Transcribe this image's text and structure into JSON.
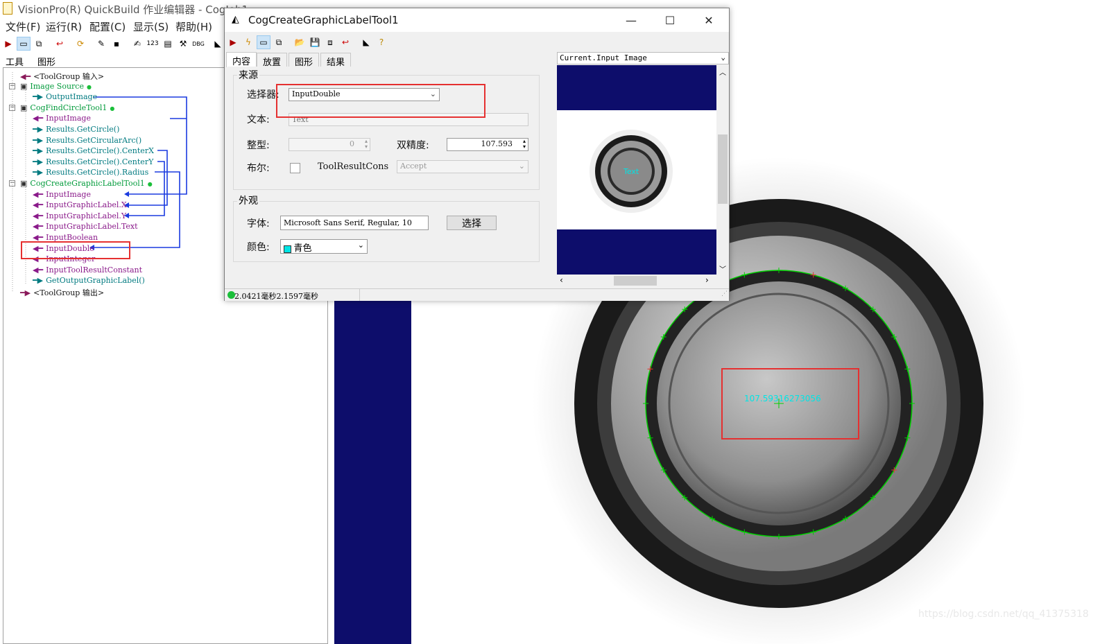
{
  "main_window": {
    "title": "VisionPro(R) QuickBuild 作业编辑器 - CogJob1",
    "menu": [
      "文件(F)",
      "运行(R)",
      "配置(C)",
      "显示(S)",
      "帮助(H)"
    ],
    "left_tabs": [
      "工具",
      "图形"
    ]
  },
  "tree": {
    "items": [
      {
        "label": "<ToolGroup 输入>",
        "color": "black"
      },
      {
        "label": "Image Source",
        "color": "green"
      },
      {
        "label": "OutputImage",
        "color": "teal"
      },
      {
        "label": "CogFindCircleTool1",
        "color": "green"
      },
      {
        "label": "InputImage",
        "color": "purple"
      },
      {
        "label": "Results.GetCircle()",
        "color": "teal"
      },
      {
        "label": "Results.GetCircularArc()",
        "color": "teal"
      },
      {
        "label": "Results.GetCircle().CenterX",
        "color": "teal"
      },
      {
        "label": "Results.GetCircle().CenterY",
        "color": "teal"
      },
      {
        "label": "Results.GetCircle().Radius",
        "color": "teal"
      },
      {
        "label": "CogCreateGraphicLabelTool1",
        "color": "green"
      },
      {
        "label": "InputImage",
        "color": "purple"
      },
      {
        "label": "InputGraphicLabel.X",
        "color": "purple"
      },
      {
        "label": "InputGraphicLabel.Y",
        "color": "purple"
      },
      {
        "label": "InputGraphicLabel.Text",
        "color": "purple"
      },
      {
        "label": "InputBoolean",
        "color": "purple"
      },
      {
        "label": "InputDouble",
        "color": "purple"
      },
      {
        "label": "InputInteger",
        "color": "purple"
      },
      {
        "label": "InputToolResultConstant",
        "color": "purple"
      },
      {
        "label": "GetOutputGraphicLabel()",
        "color": "teal"
      },
      {
        "label": "<ToolGroup 输出>",
        "color": "black"
      }
    ]
  },
  "dialog": {
    "title": "CogCreateGraphicLabelTool1",
    "tabs": [
      "内容",
      "放置",
      "图形",
      "结果"
    ],
    "source_group": "来源",
    "selector_label": "选择器:",
    "selector_value": "InputDouble",
    "text_label": "文本:",
    "text_placeholder": "Text",
    "int_label": "整型:",
    "int_value": "0",
    "double_label": "双精度:",
    "double_value": "107.593",
    "bool_label": "布尔:",
    "toolresult_label": "ToolResultCons",
    "toolresult_value": "Accept",
    "appearance_group": "外观",
    "font_label": "字体:",
    "font_value": "Microsoft Sans Serif, Regular, 10",
    "font_button": "选择",
    "color_label": "颜色:",
    "color_value": "青色",
    "preview_header": "Current.Input Image",
    "preview_label": "Text",
    "status_text": "2.0421毫秒2.1597毫秒"
  },
  "image": {
    "overlay_label": "107.59316273056"
  },
  "watermark": "https://blog.csdn.net/qq_41375318",
  "colors": {
    "navy": "#0d0d6b",
    "cyan_label": "#00e5e5",
    "circle_green": "#00d000",
    "highlight_red": "#e53030"
  }
}
